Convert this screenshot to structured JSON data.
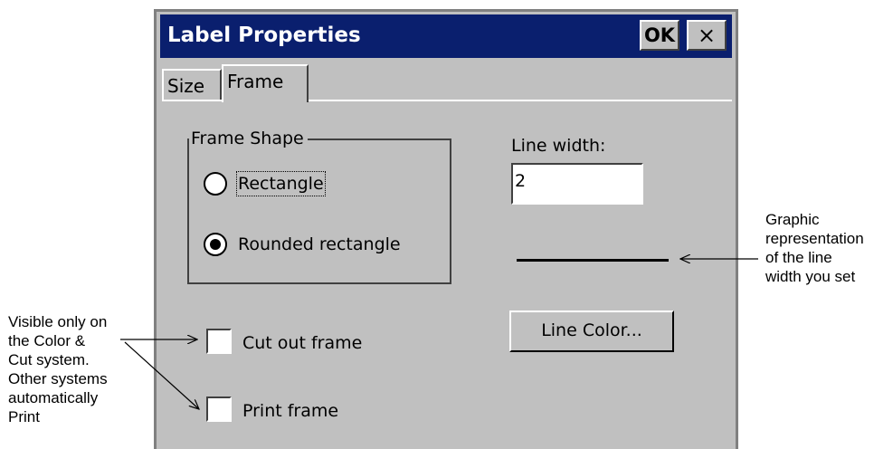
{
  "dialog": {
    "title": "Label Properties",
    "ok_label": "OK",
    "close_label": "×"
  },
  "tabs": [
    {
      "label": "Size",
      "active": false
    },
    {
      "label": "Frame",
      "active": true
    }
  ],
  "frame_shape": {
    "legend": "Frame Shape",
    "options": [
      {
        "label": "Rectangle",
        "selected": false
      },
      {
        "label": "Rounded rectangle",
        "selected": true
      }
    ]
  },
  "line_width": {
    "label": "Line width:",
    "value": "2"
  },
  "checkboxes": [
    {
      "label": "Cut out frame",
      "checked": false
    },
    {
      "label": "Print frame",
      "checked": false
    }
  ],
  "line_color_button": "Line Color...",
  "annotations": {
    "left": [
      "Visible only on",
      "the Color &",
      "Cut system.",
      "Other systems",
      "automatically",
      "Print"
    ],
    "right": [
      "Graphic",
      "representation",
      "of the line",
      "width you set"
    ]
  },
  "colors": {
    "titlebar": "#0a1f6e",
    "dialog_bg": "#c0c0c0"
  }
}
